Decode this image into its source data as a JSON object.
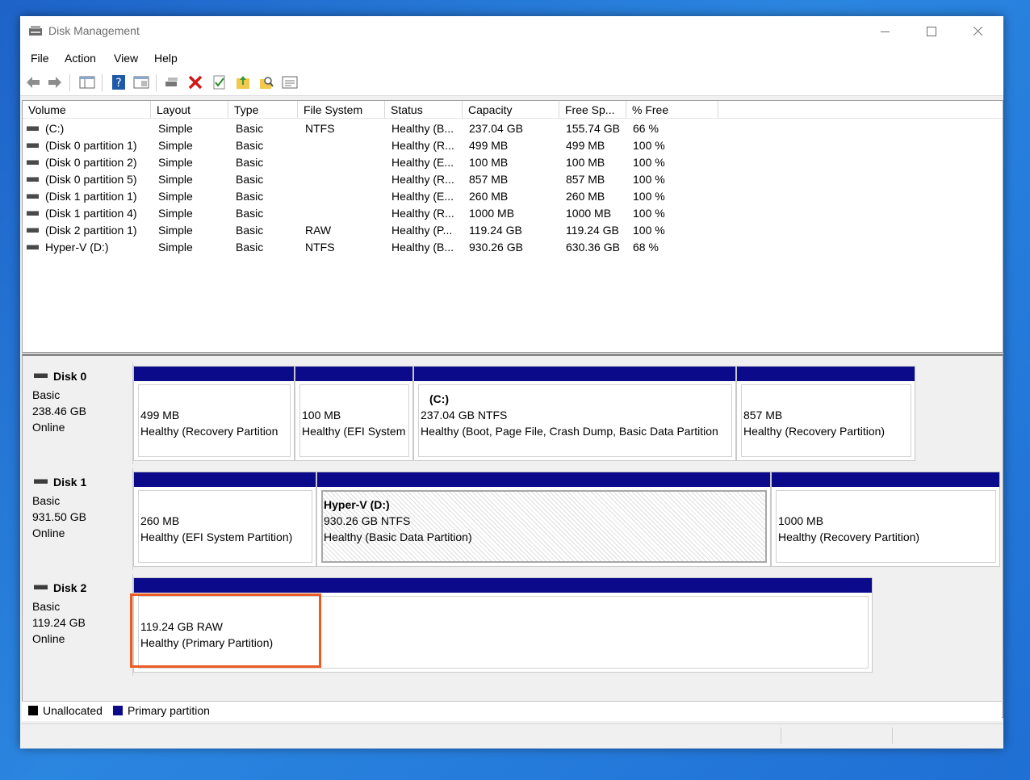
{
  "window": {
    "title": "Disk Management"
  },
  "menu": [
    "File",
    "Action",
    "View",
    "Help"
  ],
  "toolbar_icons": [
    "back-arrow-icon",
    "forward-arrow-icon",
    "console-tree-icon",
    "help-icon",
    "show-hide-icon",
    "connect-icon",
    "delete-icon",
    "check-icon",
    "new-folder-icon",
    "search-icon",
    "properties-icon"
  ],
  "columns": [
    "Volume",
    "Layout",
    "Type",
    "File System",
    "Status",
    "Capacity",
    "Free Sp...",
    "% Free"
  ],
  "volumes": [
    {
      "volume": "(C:)",
      "layout": "Simple",
      "type": "Basic",
      "fs": "NTFS",
      "status": "Healthy (B...",
      "capacity": "237.04 GB",
      "free": "155.74 GB",
      "pct": "66 %"
    },
    {
      "volume": "(Disk 0 partition 1)",
      "layout": "Simple",
      "type": "Basic",
      "fs": "",
      "status": "Healthy (R...",
      "capacity": "499 MB",
      "free": "499 MB",
      "pct": "100 %"
    },
    {
      "volume": "(Disk 0 partition 2)",
      "layout": "Simple",
      "type": "Basic",
      "fs": "",
      "status": "Healthy (E...",
      "capacity": "100 MB",
      "free": "100 MB",
      "pct": "100 %"
    },
    {
      "volume": "(Disk 0 partition 5)",
      "layout": "Simple",
      "type": "Basic",
      "fs": "",
      "status": "Healthy (R...",
      "capacity": "857 MB",
      "free": "857 MB",
      "pct": "100 %"
    },
    {
      "volume": "(Disk 1 partition 1)",
      "layout": "Simple",
      "type": "Basic",
      "fs": "",
      "status": "Healthy (E...",
      "capacity": "260 MB",
      "free": "260 MB",
      "pct": "100 %"
    },
    {
      "volume": "(Disk 1 partition 4)",
      "layout": "Simple",
      "type": "Basic",
      "fs": "",
      "status": "Healthy (R...",
      "capacity": "1000 MB",
      "free": "1000 MB",
      "pct": "100 %"
    },
    {
      "volume": "(Disk 2 partition 1)",
      "layout": "Simple",
      "type": "Basic",
      "fs": "RAW",
      "status": "Healthy (P...",
      "capacity": "119.24 GB",
      "free": "119.24 GB",
      "pct": "100 %"
    },
    {
      "volume": "Hyper-V (D:)",
      "layout": "Simple",
      "type": "Basic",
      "fs": "NTFS",
      "status": "Healthy (B...",
      "capacity": "930.26 GB",
      "free": "630.36 GB",
      "pct": "68 %"
    }
  ],
  "disks": [
    {
      "name": "Disk 0",
      "kind": "Basic",
      "size": "238.46 GB",
      "state": "Online",
      "partitions": [
        {
          "label": "",
          "l1": "499 MB",
          "l2": "Healthy (Recovery Partition",
          "hatched": false
        },
        {
          "label": "",
          "l1": "100 MB",
          "l2": "Healthy (EFI System",
          "hatched": false
        },
        {
          "label": "(C:)",
          "l1": "237.04 GB NTFS",
          "l2": "Healthy (Boot, Page File, Crash Dump, Basic Data Partition",
          "hatched": false
        },
        {
          "label": "",
          "l1": "857 MB",
          "l2": "Healthy (Recovery Partition)",
          "hatched": false
        }
      ]
    },
    {
      "name": "Disk 1",
      "kind": "Basic",
      "size": "931.50 GB",
      "state": "Online",
      "partitions": [
        {
          "label": "",
          "l1": "260 MB",
          "l2": "Healthy (EFI System Partition)",
          "hatched": false
        },
        {
          "label": "Hyper-V  (D:)",
          "l1": "930.26 GB NTFS",
          "l2": "Healthy (Basic Data Partition)",
          "hatched": true
        },
        {
          "label": "",
          "l1": "1000 MB",
          "l2": "Healthy (Recovery Partition)",
          "hatched": false
        }
      ]
    },
    {
      "name": "Disk 2",
      "kind": "Basic",
      "size": "119.24 GB",
      "state": "Online",
      "partitions": [
        {
          "label": "",
          "l1": "119.24 GB RAW",
          "l2": "Healthy (Primary Partition)",
          "hatched": false
        }
      ]
    }
  ],
  "legend": [
    {
      "label": "Unallocated",
      "color": "#000000"
    },
    {
      "label": "Primary partition",
      "color": "#0a0a8a"
    }
  ],
  "colors": {
    "partition_bar": "#0a0a8a",
    "highlight": "#ec5b24"
  }
}
